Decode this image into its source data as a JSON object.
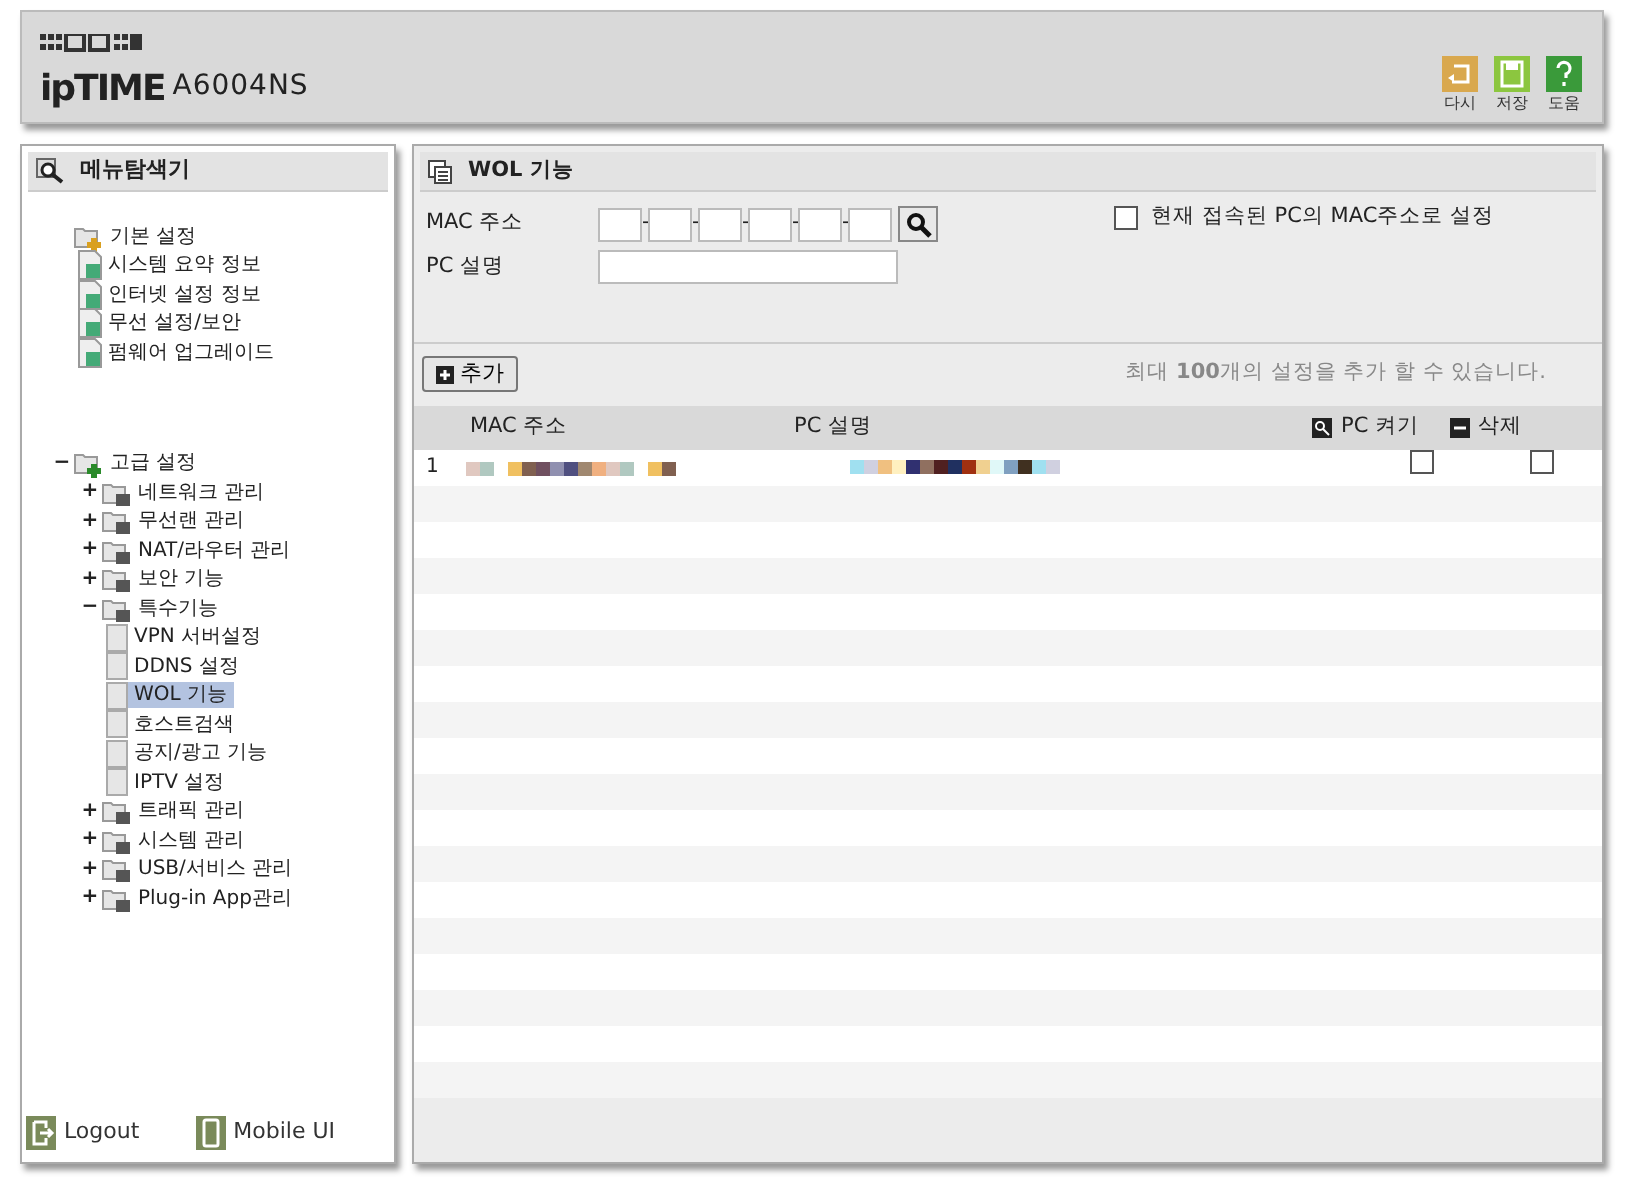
{
  "header": {
    "logo": "ipTIME",
    "model": "A6004NS",
    "buttons": [
      {
        "kind": "undo",
        "label": "다시"
      },
      {
        "kind": "save",
        "label": "저장"
      },
      {
        "kind": "help",
        "label": "도움"
      }
    ]
  },
  "sidebar": {
    "title": "메뉴탐색기",
    "tree": [
      {
        "label": "기본 설정",
        "expanded": true,
        "children": [
          {
            "label": "시스템 요약 정보",
            "selected": false
          },
          {
            "label": "인터넷 설정 정보",
            "selected": false
          },
          {
            "label": "무선 설정/보안",
            "selected": false
          },
          {
            "label": "펌웨어 업그레이드",
            "selected": false
          }
        ]
      },
      {
        "label": "고급 설정",
        "expanded": true,
        "toggle": "−",
        "children": [
          {
            "label": "네트워크 관리",
            "expanded": false,
            "toggle": "+",
            "selected": false
          },
          {
            "label": "무선랜 관리",
            "expanded": false,
            "toggle": "+",
            "selected": false
          },
          {
            "label": "NAT/라우터 관리",
            "expanded": false,
            "toggle": "+",
            "selected": false
          },
          {
            "label": "보안 기능",
            "expanded": false,
            "toggle": "+",
            "selected": false
          },
          {
            "label": "특수기능",
            "expanded": true,
            "toggle": "−",
            "selected": false,
            "children": [
              {
                "label": "VPN 서버설정",
                "selected": false
              },
              {
                "label": "DDNS 설정",
                "selected": false
              },
              {
                "label": "WOL 기능",
                "selected": true
              },
              {
                "label": "호스트검색",
                "selected": false
              },
              {
                "label": "공지/광고 기능",
                "selected": false
              },
              {
                "label": "IPTV 설정",
                "selected": false
              }
            ]
          },
          {
            "label": "트래픽 관리",
            "expanded": false,
            "toggle": "+",
            "selected": false
          },
          {
            "label": "시스템 관리",
            "expanded": false,
            "toggle": "+",
            "selected": false
          },
          {
            "label": "USB/서비스 관리",
            "expanded": false,
            "toggle": "+",
            "selected": false
          },
          {
            "label": "Plug-in App관리",
            "expanded": false,
            "toggle": "+",
            "selected": false
          }
        ]
      }
    ],
    "footer": [
      {
        "kind": "logout",
        "label": "Logout"
      },
      {
        "kind": "mobile",
        "label": "Mobile UI"
      }
    ]
  },
  "panel": {
    "title": "WOL 기능",
    "form": {
      "mac_label": "MAC 주소",
      "mac_fields": [
        {
          "kind": "octet",
          "separator_after": "-"
        },
        {
          "kind": "octet",
          "separator_after": "-"
        },
        {
          "kind": "octet",
          "separator_after": "-"
        },
        {
          "kind": "octet",
          "separator_after": "-"
        },
        {
          "kind": "octet",
          "separator_after": "-"
        },
        {
          "kind": "octet"
        }
      ],
      "use_current_mac": {
        "label": "현재 접속된 PC의 MAC주소로 설정",
        "checked": false
      },
      "pc_label": "PC 설명"
    },
    "add_button": "추가",
    "limit_note": "최대 **100**개의 설정을 추가 할 수 있습니다.",
    "table": {
      "columns": [
        {
          "label": "MAC 주소"
        },
        {
          "label": "PC 설명"
        },
        {
          "kind": "power",
          "label": "PC 켜기"
        },
        {
          "kind": "delete",
          "label": "삭제"
        }
      ],
      "rows": [
        {
          "number": "1",
          "mac": {
            "kind": "pixelated"
          },
          "pc_name": {
            "kind": "pixelated"
          },
          "power_on": false,
          "delete": false
        }
      ]
    }
  }
}
